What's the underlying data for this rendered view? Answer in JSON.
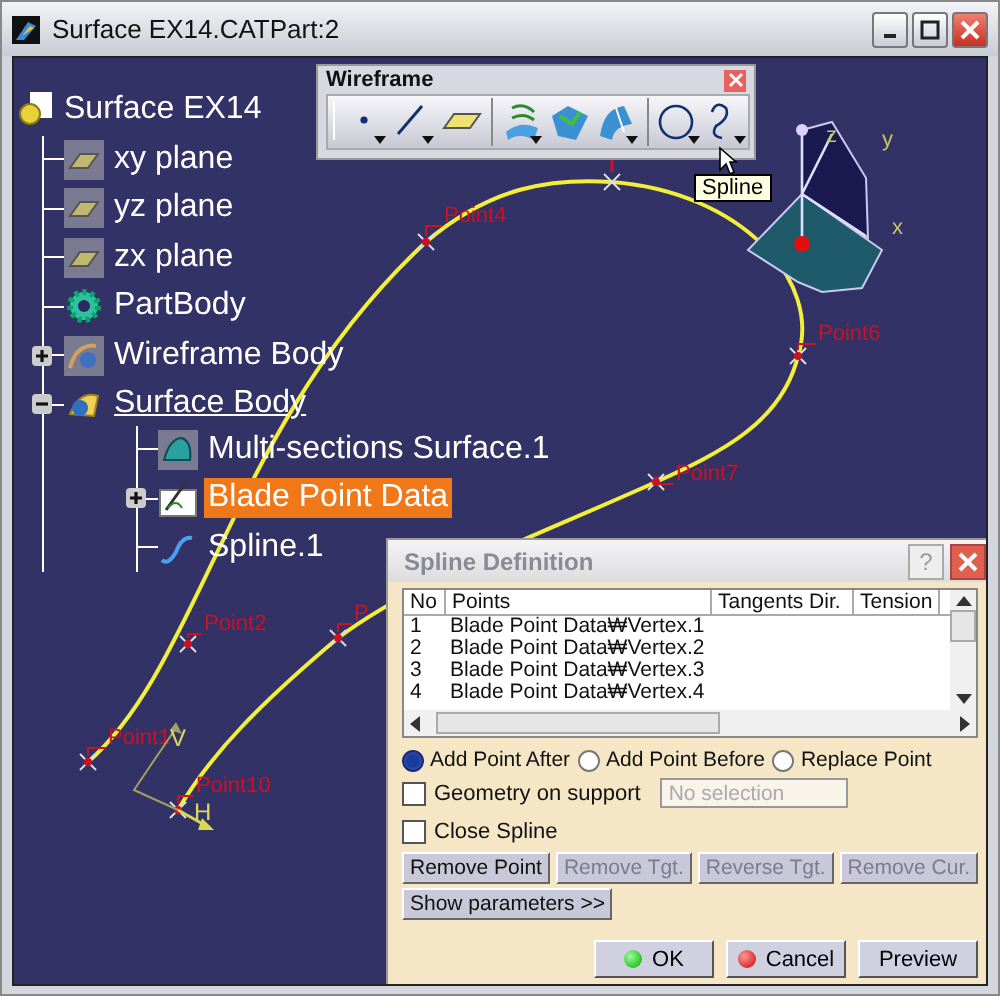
{
  "window": {
    "title": "Surface EX14.CATPart:2"
  },
  "tree": {
    "label": "Surface EX14",
    "kind": "part",
    "current": false,
    "children": [
      {
        "label": "xy plane",
        "kind": "plane",
        "current": false,
        "selected": false
      },
      {
        "label": "yz plane",
        "kind": "plane",
        "current": false,
        "selected": false
      },
      {
        "label": "zx plane",
        "kind": "plane",
        "current": false,
        "selected": false
      },
      {
        "label": "PartBody",
        "kind": "body",
        "current": false,
        "selected": false
      },
      {
        "label": "Wireframe Body",
        "kind": "geoset",
        "current": false,
        "selected": false,
        "expanded": false
      },
      {
        "label": "Surface Body",
        "kind": "surfset",
        "current": true,
        "selected": false,
        "expanded": true,
        "children": [
          {
            "label": "Multi-sections Surface.1",
            "kind": "surface",
            "current": false,
            "selected": false
          },
          {
            "label": "Blade Point Data",
            "kind": "sketch",
            "current": false,
            "selected": true,
            "expanded": false
          },
          {
            "label": "Spline.1",
            "kind": "spline",
            "current": false,
            "selected": false
          }
        ]
      }
    ]
  },
  "toolbar": {
    "title": "Wireframe",
    "tools": [
      {
        "kind": "point"
      },
      {
        "kind": "line"
      },
      {
        "kind": "plane"
      },
      {
        "kind": "sep"
      },
      {
        "kind": "project"
      },
      {
        "kind": "combine"
      },
      {
        "kind": "reflect"
      },
      {
        "kind": "sep"
      },
      {
        "kind": "circle"
      },
      {
        "kind": "spline"
      }
    ],
    "tooltip": "Spline"
  },
  "canvas": {
    "points": [
      {
        "label": "Point1"
      },
      {
        "label": "Point2"
      },
      {
        "label": "Point4"
      },
      {
        "label": "Point6"
      },
      {
        "label": "Point7"
      },
      {
        "label": "P"
      },
      {
        "label": "Point10"
      }
    ],
    "axis": {
      "v": "V",
      "h": "H"
    },
    "compass": {
      "z": "z",
      "y": "y",
      "x": "x"
    }
  },
  "dialog": {
    "title": "Spline Definition",
    "help": "?",
    "columns": [
      "No",
      "Points",
      "Tangents Dir.",
      "Tension"
    ],
    "rows": [
      {
        "no": "1",
        "point": "Blade Point Data₩Vertex.1"
      },
      {
        "no": "2",
        "point": "Blade Point Data₩Vertex.2"
      },
      {
        "no": "3",
        "point": "Blade Point Data₩Vertex.3"
      },
      {
        "no": "4",
        "point": "Blade Point Data₩Vertex.4"
      }
    ],
    "radios": [
      {
        "label": "Add Point After",
        "selected": true
      },
      {
        "label": "Add Point Before",
        "selected": false
      },
      {
        "label": "Replace Point",
        "selected": false
      }
    ],
    "geometry_on_support": {
      "label": "Geometry on support",
      "checked": false,
      "field": {
        "value": "No selection",
        "disabled": true
      }
    },
    "close_spline": {
      "label": "Close Spline",
      "checked": false
    },
    "buttons": [
      {
        "label": "Remove Point",
        "disabled": false
      },
      {
        "label": "Remove Tgt.",
        "disabled": true
      },
      {
        "label": "Reverse Tgt.",
        "disabled": true
      },
      {
        "label": "Remove Cur.",
        "disabled": true
      }
    ],
    "show_parameters": "Show parameters >>",
    "footer": [
      {
        "label": "OK",
        "kind": "ok"
      },
      {
        "label": "Cancel",
        "kind": "cancel"
      },
      {
        "label": "Preview",
        "kind": "plain"
      }
    ]
  }
}
